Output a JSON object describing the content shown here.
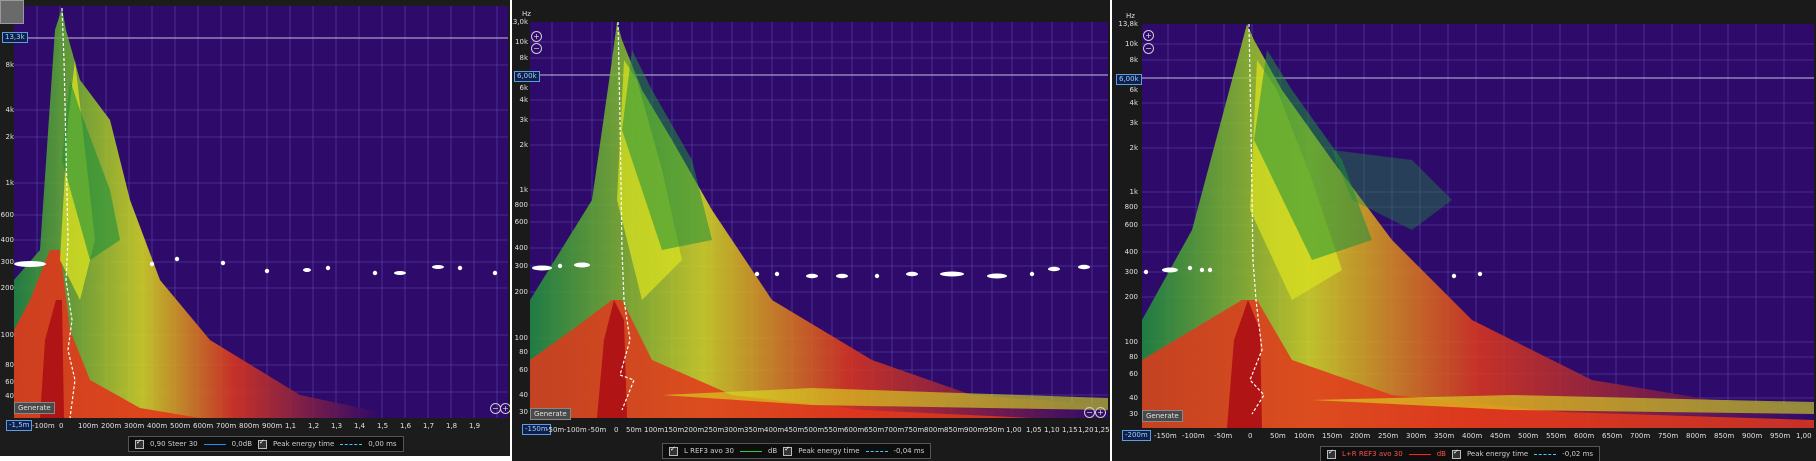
{
  "colors": {
    "background": "#2e0a6b",
    "grid": "#5f4aa8",
    "hot": "#cc1f1f",
    "dots": "#ffffff"
  },
  "panels": [
    {
      "id": "panel1",
      "unit": "",
      "marker": "13,3k",
      "y_labels": [
        "8k",
        "4k",
        "2k",
        "1k",
        "600",
        "400",
        "300",
        "200",
        "100",
        "80",
        "60",
        "40"
      ],
      "x_start_label": "-1,5m",
      "x_labels": [
        "-100m",
        "0",
        "100m",
        "200m",
        "300m",
        "400m",
        "500m",
        "600m",
        "700m",
        "800m",
        "900m",
        "1,1",
        "1,2",
        "1,3",
        "1,4",
        "1,5",
        "1,6",
        "1,7",
        "1,8",
        "1,9"
      ],
      "generate": "Generate",
      "legend": {
        "series_label": "0,90 Steer 30",
        "series_value": "0,0dB",
        "peak_label": "Peak energy time",
        "peak_value": "0,00 ms",
        "series_color": "#1e90ff",
        "peak_color": "#40c8ff"
      }
    },
    {
      "id": "panel2",
      "unit": "Hz",
      "top_label": "13,0k",
      "marker": "6,00k",
      "y_labels": [
        "10k",
        "8k",
        "6k",
        "4k",
        "3k",
        "2k",
        "1k",
        "800",
        "600",
        "400",
        "300",
        "200",
        "100",
        "80",
        "60",
        "40",
        "30"
      ],
      "x_start_label": "-150m",
      "x_labels": [
        "-50m",
        "-100m",
        "-50m",
        "0",
        "50m",
        "100m",
        "150m",
        "200m",
        "250m",
        "300m",
        "350m",
        "400m",
        "450m",
        "500m",
        "550m",
        "600m",
        "650m",
        "700m",
        "750m",
        "800m",
        "850m",
        "900m",
        "950m",
        "1,00",
        "1,05",
        "1,10",
        "1,15",
        "1,20",
        "1,25"
      ],
      "generate": "Generate",
      "legend": {
        "series_label": "L REF3 avo 30",
        "series_value": "dB",
        "peak_label": "Peak energy time",
        "peak_value": "-0,04 ms",
        "series_color": "#2ecc40",
        "peak_color": "#40c8ff"
      }
    },
    {
      "id": "panel3",
      "unit": "Hz",
      "top_label": "13,8k",
      "marker": "6,00k",
      "y_labels": [
        "10k",
        "8k",
        "6k",
        "4k",
        "3k",
        "2k",
        "1k",
        "800",
        "600",
        "400",
        "300",
        "200",
        "100",
        "80",
        "60",
        "40",
        "30"
      ],
      "x_start_label": "-200m",
      "x_labels": [
        "-150m",
        "-100m",
        "-50m",
        "0",
        "50m",
        "100m",
        "150m",
        "200m",
        "250m",
        "300m",
        "350m",
        "400m",
        "450m",
        "500m",
        "550m",
        "600m",
        "650m",
        "700m",
        "750m",
        "800m",
        "850m",
        "900m",
        "950m",
        "1,00"
      ],
      "generate": "Generate",
      "legend": {
        "series_label": "L+R REF3 avo 30",
        "series_value": "dB",
        "peak_label": "Peak energy time",
        "peak_value": "-0,02 ms",
        "series_color": "#ff2020",
        "peak_color": "#40c8ff"
      }
    }
  ]
}
